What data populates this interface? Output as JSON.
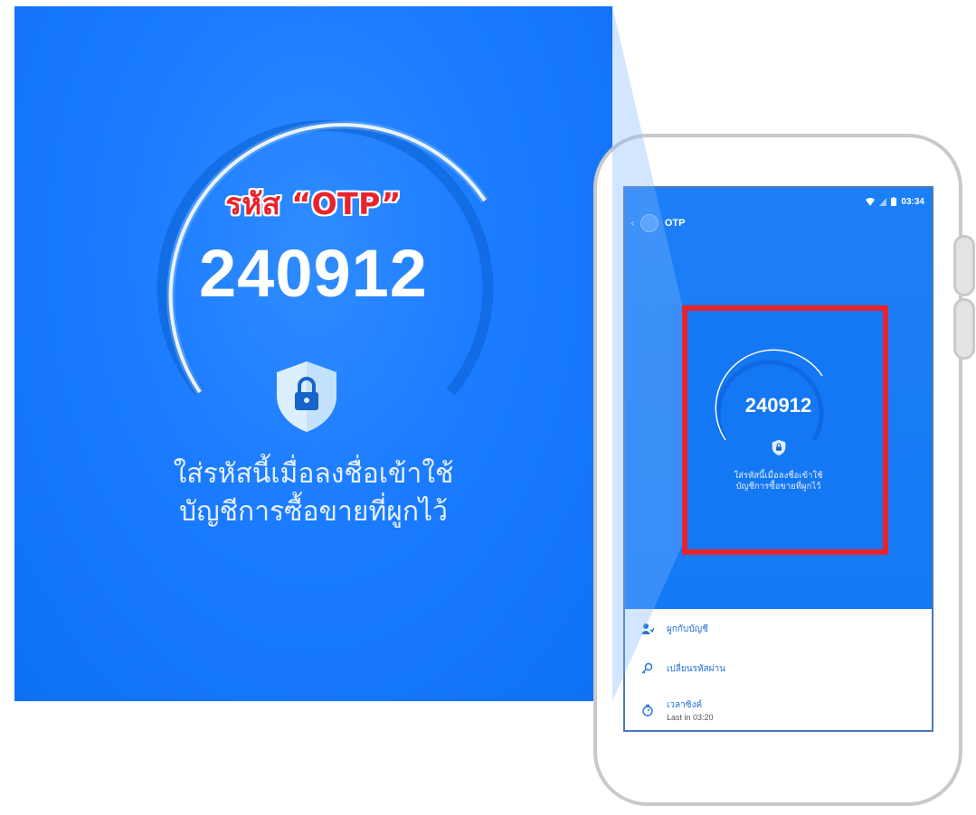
{
  "zoom": {
    "label": "รหัส “OTP”",
    "otp_code": "240912",
    "caption_line1": "ใส่รหัสนี้เมื่อลงชื่อเข้าใช้",
    "caption_line2": "บัญชีการซื้อขายที่ผูกไว้"
  },
  "phone": {
    "status_time": "03:34",
    "app_title": "OTP",
    "otp_code": "240912",
    "caption_line1": "ใส่รหัสนี้เมื่อลงชื่อเข้าใช้",
    "caption_line2": "บัญชีการซื้อขายที่ผูกไว้",
    "menu": [
      {
        "label": "ผูกกับบัญชี",
        "icon": "person-link-icon"
      },
      {
        "label": "เปลี่ยนรหัสผ่าน",
        "icon": "key-icon"
      },
      {
        "label": "เวลาซิงค์",
        "sub": "Last in 03:20",
        "icon": "timer-icon"
      }
    ]
  },
  "colors": {
    "brand_blue": "#1479f4",
    "highlight_red": "#e8232d",
    "link_blue": "#1f73d8"
  }
}
